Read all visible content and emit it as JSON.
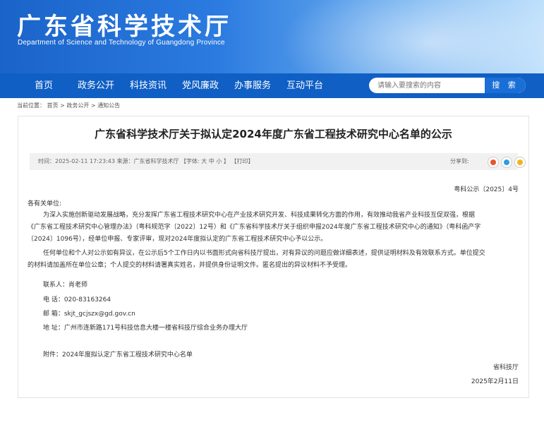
{
  "header": {
    "title": "广东省科学技术厅",
    "subtitle": "Department of Science and Technology of Guangdong Province"
  },
  "nav": {
    "items": [
      "首页",
      "政务公开",
      "科技资讯",
      "党风廉政",
      "办事服务",
      "互动平台"
    ]
  },
  "search": {
    "placeholder": "请输入要搜索的内容",
    "button": "搜 索"
  },
  "breadcrumb": "当前位置： 首页 > 政务公开 > 通知公告",
  "article": {
    "title": "广东省科学技术厅关于拟认定2024年度广东省工程技术研究中心名单的公示",
    "meta": "时间：2025-02-11 17:23:43    来源：广东省科学技术厅  【字体: 大   中   小 】 【打印】",
    "share_label": "分享到:",
    "doc_number": "粤科公示〔2025〕4号",
    "salutation": "各有关单位:",
    "para1_lines": [
      "为深入实施创新驱动发展战略，充分发挥广东省工程技术研究中心在产业技术研究开发、科技成果转化方面的作用，有效推动我省产业科技互促双强，根据",
      "《广东省工程技术研究中心管理办法》（粤科规范字〔2022〕12号）和《广东省科学技术厅关于组织申报2024年度广东省工程技术研究中心的通知》（粤科函产字",
      "〔2024〕1096号），经单位申报、专家评审，现对2024年度拟认定的广东省工程技术研究中心予以公示。"
    ],
    "para2_lines": [
      "任何单位和个人对公示如有异议，在公示后5个工作日内以书面形式向省科技厅提出，对有异议的问题应做详细表述，提供证明材料及有效联系方式。单位提交",
      "的材料请加盖所在单位公章；个人提交的材料请署真实姓名，并提供身份证明文件。匿名提出的异议材料不予受理。"
    ],
    "contact": "联系人：肖老师",
    "phone": "电  话：020-83163264",
    "email": "邮  箱：skjt_gcjszx@gd.gov.cn",
    "address": "地  址：广州市连新路171号科技信息大楼一楼省科技厅综合业务办理大厅",
    "attachment": "附件：2024年度拟认定广东省工程技术研究中心名单",
    "signer": "省科技厅",
    "date": "2025年2月11日"
  },
  "colors": {
    "nav": "#0f5fc4",
    "search_button": "#1a6fd6"
  }
}
